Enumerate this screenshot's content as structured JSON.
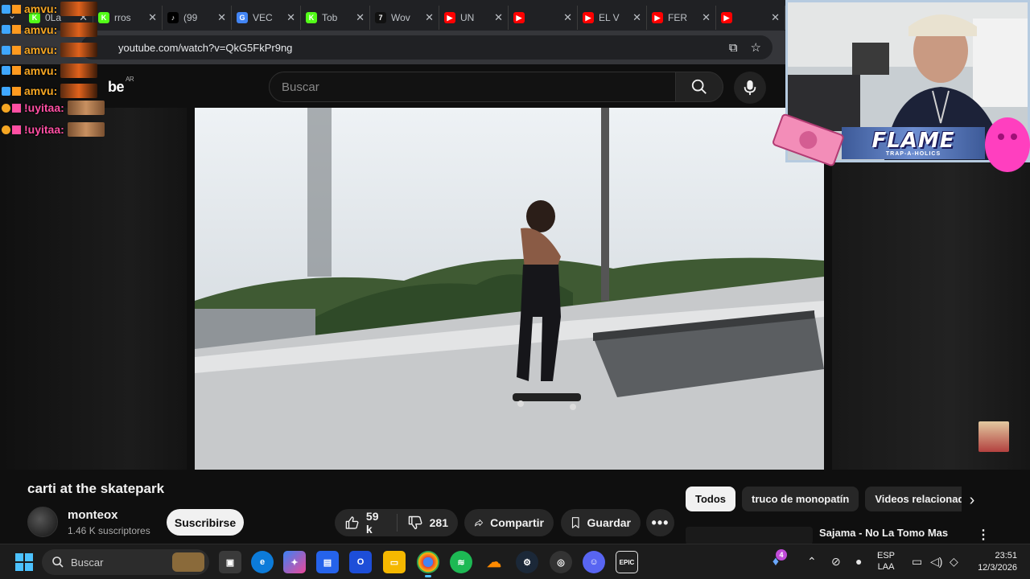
{
  "browser": {
    "tabs": [
      {
        "label": "0La",
        "fav_color": "#53fc18",
        "fav_glyph": "K"
      },
      {
        "label": "rros",
        "fav_color": "#53fc18",
        "fav_glyph": "K"
      },
      {
        "label": "(99",
        "fav_color": "#000000",
        "fav_glyph": "♪"
      },
      {
        "label": "VEC",
        "fav_color": "#4285f4",
        "fav_glyph": "G"
      },
      {
        "label": "Tob",
        "fav_color": "#53fc18",
        "fav_glyph": "K"
      },
      {
        "label": "Wov",
        "fav_color": "#111111",
        "fav_glyph": "7"
      },
      {
        "label": "UN",
        "fav_color": "#ff0000",
        "fav_glyph": "▶"
      },
      {
        "label": "",
        "fav_color": "#ff0000",
        "fav_glyph": "▶"
      },
      {
        "label": "EL V",
        "fav_color": "#ff0000",
        "fav_glyph": "▶"
      },
      {
        "label": "FER",
        "fav_color": "#ff0000",
        "fav_glyph": "▶"
      },
      {
        "label": "",
        "fav_color": "#ff0000",
        "fav_glyph": "▶"
      }
    ],
    "url": "youtube.com/watch?v=QkG5FkPr9ng"
  },
  "youtube": {
    "logo": "be",
    "region": "AR",
    "search_placeholder": "Buscar"
  },
  "chat": [
    {
      "name": "amvu:",
      "color": "#f5a623"
    },
    {
      "name": "amvu:",
      "color": "#f5a623"
    },
    {
      "name": "amvu:",
      "color": "#f5a623"
    },
    {
      "name": "amvu:",
      "color": "#f5a623"
    },
    {
      "name": "amvu:",
      "color": "#f5a623"
    },
    {
      "name": "!uyitaa:",
      "color": "#ff4fa3"
    },
    {
      "name": "!uyitaa:",
      "color": "#ff4fa3"
    }
  ],
  "stream_overlay": {
    "banner_title": "FLAME",
    "banner_sub": "TRAP-A-HOLICS"
  },
  "video": {
    "title": "carti at the skatepark",
    "channel": "monteox",
    "subscribers": "1.46 K suscriptores",
    "subscribe_label": "Suscribirse",
    "likes": "59 k",
    "dislikes": "281",
    "share_label": "Compartir",
    "save_label": "Guardar"
  },
  "chips": [
    "Todos",
    "truco de monopatín",
    "Videos relacionad"
  ],
  "recommendation": {
    "title": "Sajama - No La Tomo Mas"
  },
  "taskbar": {
    "search_label": "Buscar",
    "lang_top": "ESP",
    "lang_bottom": "LAA",
    "time": "23:51",
    "date": "12/3/2026",
    "notification_count": "4"
  },
  "colors": {
    "accent": "#4cc2ff",
    "youtube_red": "#ff0000",
    "background": "#0f0f0f"
  }
}
